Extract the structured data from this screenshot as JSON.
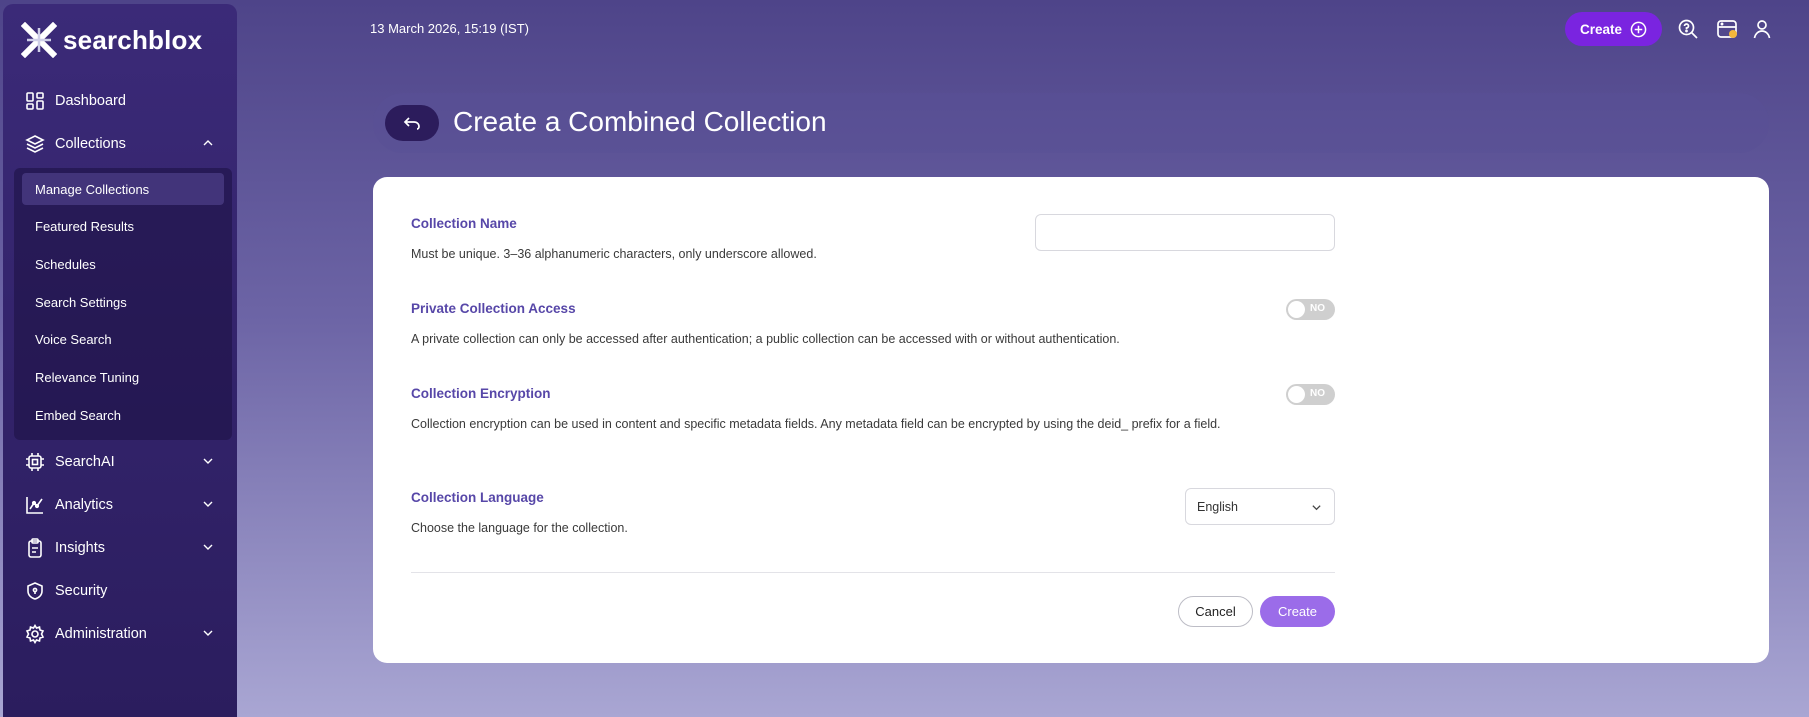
{
  "app": {
    "brand": "searchblox"
  },
  "topbar": {
    "datetime": "13 March 2026, 15:19 (IST)",
    "create_label": "Create"
  },
  "sidebar": {
    "items": [
      {
        "label": "Dashboard",
        "icon": "dashboard-icon"
      },
      {
        "label": "Collections",
        "icon": "layers-icon",
        "expanded": true
      },
      {
        "label": "SearchAI",
        "icon": "chip-icon"
      },
      {
        "label": "Analytics",
        "icon": "chart-icon"
      },
      {
        "label": "Insights",
        "icon": "clipboard-icon"
      },
      {
        "label": "Security",
        "icon": "shield-icon"
      },
      {
        "label": "Administration",
        "icon": "gear-icon"
      }
    ],
    "collections_sub": [
      "Manage Collections",
      "Featured Results",
      "Schedules",
      "Search Settings",
      "Voice Search",
      "Relevance Tuning",
      "Embed Search"
    ]
  },
  "page": {
    "title": "Create a Combined Collection"
  },
  "form": {
    "name": {
      "label": "Collection Name",
      "desc": "Must be unique. 3–36 alphanumeric characters, only underscore allowed.",
      "value": ""
    },
    "private": {
      "label": "Private Collection Access",
      "desc": "A private collection can only be accessed after authentication; a public collection can be accessed with or without authentication.",
      "toggle": "NO"
    },
    "encryption": {
      "label": "Collection Encryption",
      "desc": "Collection encryption can be used in content and specific metadata fields. Any metadata field can be encrypted by using the deid_ prefix for a field.",
      "toggle": "NO"
    },
    "language": {
      "label": "Collection Language",
      "desc": "Choose the language for the collection.",
      "selected": "English"
    },
    "cancel_label": "Cancel",
    "create_label": "Create"
  },
  "colors": {
    "accent": "#7a24e0",
    "create_button": "#9b6ce9",
    "label": "#5747a8",
    "sidebar": "#2b1d5e"
  }
}
